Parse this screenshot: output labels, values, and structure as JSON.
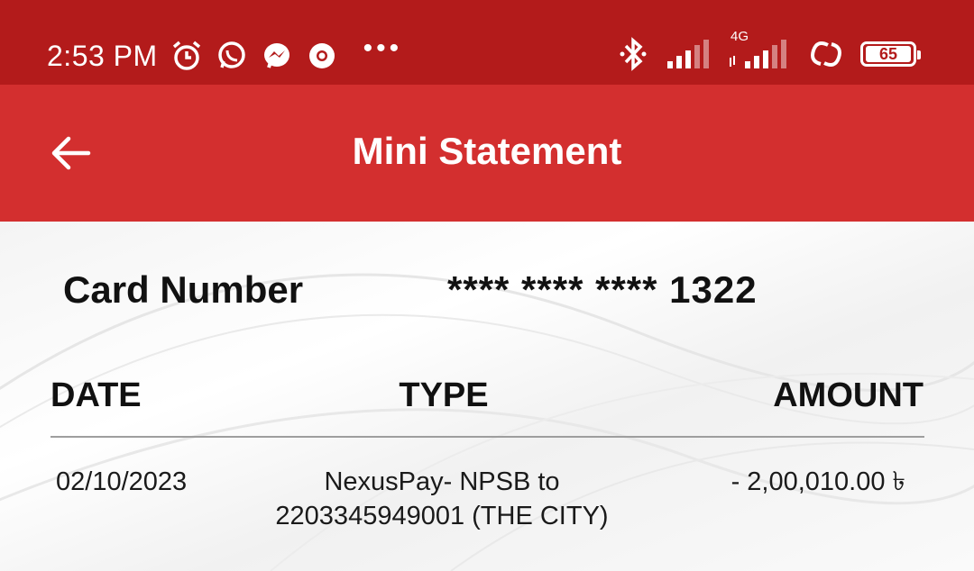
{
  "status_bar": {
    "time": "2:53 PM",
    "network_type": "4G",
    "battery_level": "65",
    "overflow_indicator": "•••"
  },
  "app_bar": {
    "title": "Mini Statement",
    "back_icon": "arrow-left-icon"
  },
  "card": {
    "label": "Card Number",
    "value": "**** **** **** 1322"
  },
  "table": {
    "headers": {
      "date": "DATE",
      "type": "TYPE",
      "amount": "AMOUNT"
    },
    "rows": [
      {
        "date": "02/10/2023",
        "type": "NexusPay- NPSB to 2203345949001 (THE CITY)",
        "amount": "- 2,00,010.00 ৳"
      }
    ]
  },
  "colors": {
    "status_bar_bg": "#b31b1b",
    "app_bar_bg": "#d32f2f"
  }
}
